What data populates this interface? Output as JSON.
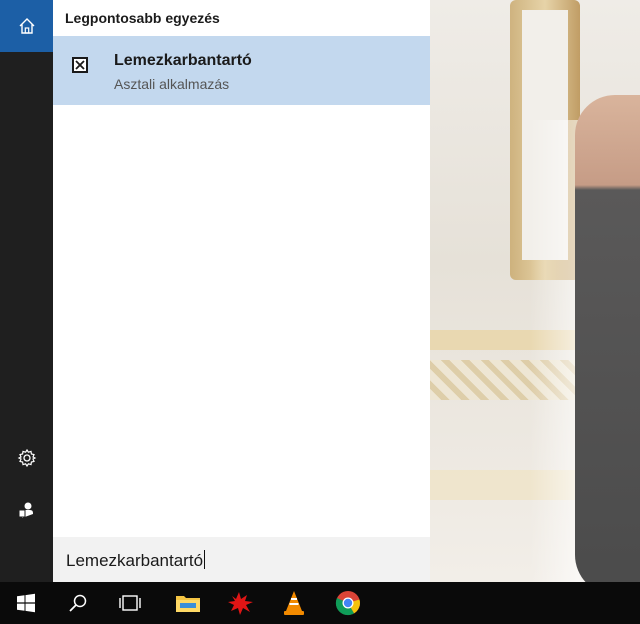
{
  "start_menu": {
    "rail": {
      "home_icon": "home-icon",
      "settings_icon": "gear-icon",
      "user_icon": "user-icon"
    },
    "results": {
      "section_title": "Legpontosabb egyezés",
      "best_match": {
        "title": "Lemezkarbantartó",
        "subtitle": "Asztali alkalmazás",
        "icon": "disk-cleanup-icon"
      }
    },
    "search": {
      "query": "Lemezkarbantartó"
    }
  },
  "taskbar": {
    "items": [
      "windows-start-icon",
      "search-icon",
      "task-view-icon",
      "file-explorer-icon",
      "paint-splash-app-icon",
      "vlc-icon",
      "chrome-icon"
    ]
  },
  "colors": {
    "accent": "#1c5fa6",
    "selected_result": "#c3d8ee",
    "rail_bg": "#1f1f1f",
    "taskbar_bg": "#0a0a0a"
  }
}
